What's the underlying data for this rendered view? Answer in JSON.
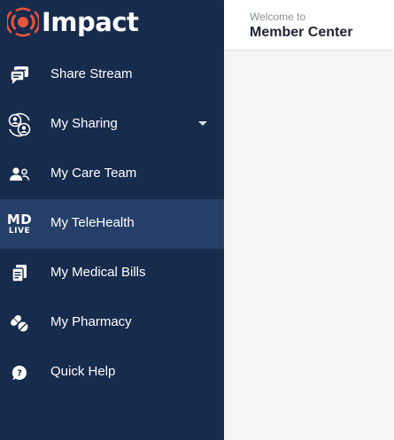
{
  "brand": {
    "name": "Impact",
    "logo_icon": "impact-logo-icon",
    "logo_color": "#e8553a"
  },
  "header": {
    "welcome": "Welcome to",
    "title": "Member Center"
  },
  "sidebar": {
    "background_color": "#172b4d",
    "active_color": "#253f68",
    "items": [
      {
        "label": "Share Stream",
        "icon": "share-stream-icon",
        "active": false
      },
      {
        "label": "My Sharing",
        "icon": "sharing-people-icon",
        "active": false,
        "expandable": true
      },
      {
        "label": "My Care Team",
        "icon": "care-team-icon",
        "active": false
      },
      {
        "label": "My TeleHealth",
        "icon": "mdlive-icon",
        "icon_text_top": "MD",
        "icon_text_bottom": "LIVE",
        "active": true
      },
      {
        "label": "My Medical Bills",
        "icon": "medical-bills-icon",
        "active": false
      },
      {
        "label": "My Pharmacy",
        "icon": "pharmacy-pills-icon",
        "active": false
      },
      {
        "label": "Quick Help",
        "icon": "help-icon",
        "active": false
      }
    ]
  }
}
